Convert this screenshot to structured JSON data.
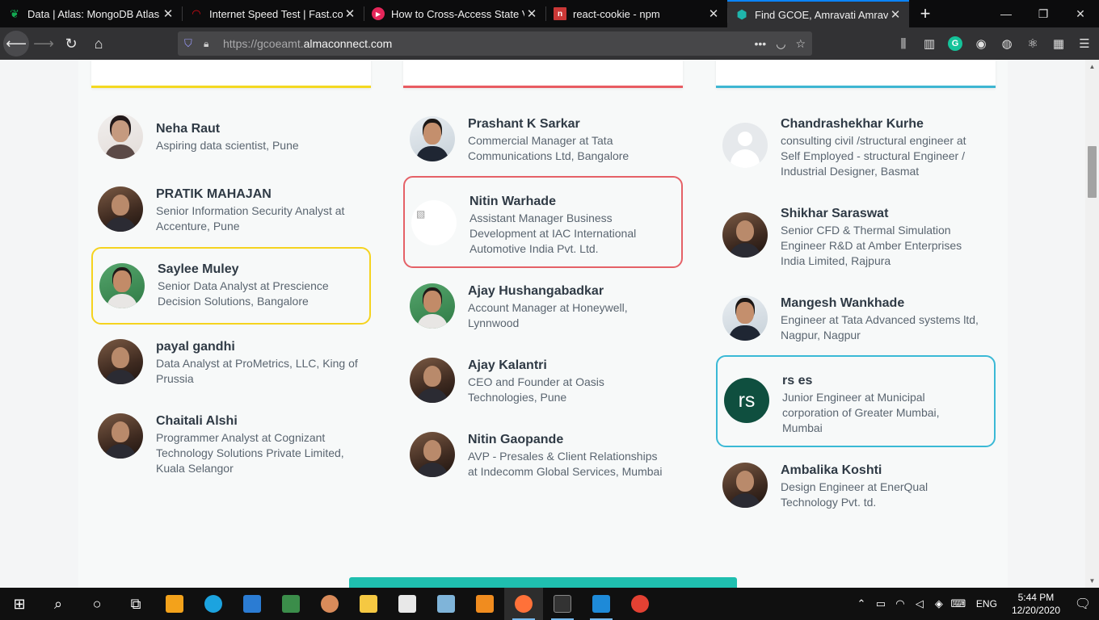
{
  "browser": {
    "tabs": [
      {
        "title": "Data | Atlas: MongoDB Atlas",
        "icon": "leaf-icon",
        "color": "#13aa52"
      },
      {
        "title": "Internet Speed Test | Fast.com",
        "icon": "speedometer-icon",
        "color": "#e50914"
      },
      {
        "title": "How to Cross-Access State Valu",
        "icon": "play-icon",
        "color": "#e5265a"
      },
      {
        "title": "react-cookie - npm",
        "icon": "npm-icon",
        "color": "#cb3837"
      },
      {
        "title": "Find GCOE, Amravati Amravati",
        "icon": "hexagon-icon",
        "color": "#1fb5ac"
      }
    ],
    "new_tab_symbol": "+",
    "url_prefix": "https://gcoeamt.",
    "url_domain": "almaconnect.com"
  },
  "columns": [
    {
      "accent": "#f4d821",
      "people": [
        {
          "name": "Neha Raut",
          "desc": "Aspiring data scientist, Pune",
          "avatar": "av-light"
        },
        {
          "name": "PRATIK MAHAJAN",
          "desc": "Senior Information Security Analyst at Accenture, Pune",
          "avatar": "av-photo"
        },
        {
          "name": "Saylee Muley",
          "desc": "Senior Data Analyst at Prescience Decision Solutions, Bangalore",
          "avatar": "av-green",
          "highlight": true
        },
        {
          "name": "payal gandhi",
          "desc": "Data Analyst at ProMetrics, LLC, King of Prussia",
          "avatar": "av-photo"
        },
        {
          "name": "Chaitali Alshi",
          "desc": "Programmer Analyst at Cognizant Technology Solutions Private Limited, Kuala Selangor",
          "avatar": "av-photo"
        }
      ]
    },
    {
      "accent": "#e85b62",
      "people": [
        {
          "name": "Prashant K Sarkar",
          "desc": "Commercial Manager at Tata Communications Ltd, Bangalore",
          "avatar": "av-suit"
        },
        {
          "name": "Nitin Warhade",
          "desc": "Assistant Manager Business Development at IAC International Automotive India Pvt. Ltd.",
          "avatar": "av-broken",
          "highlight": true
        },
        {
          "name": "Ajay Hushangabadkar",
          "desc": "Account Manager at Honeywell, Lynnwood",
          "avatar": "av-green"
        },
        {
          "name": "Ajay Kalantri",
          "desc": "CEO and Founder at Oasis Technologies, Pune",
          "avatar": "av-photo"
        },
        {
          "name": "Nitin Gaopande",
          "desc": "AVP - Presales & Client Relationships at Indecomm Global Services, Mumbai",
          "avatar": "av-photo"
        }
      ]
    },
    {
      "accent": "#3eb6d2",
      "people": [
        {
          "name": "Chandrashekhar Kurhe",
          "desc": "consulting civil /structural engineer at Self Employed - structural Engineer / Industrial Designer, Basmat",
          "avatar": "av-blank"
        },
        {
          "name": "Shikhar Saraswat",
          "desc": "Senior CFD & Thermal Simulation Engineer R&D at Amber Enterprises India Limited, Rajpura",
          "avatar": "av-photo"
        },
        {
          "name": "Mangesh Wankhade",
          "desc": "Engineer at Tata Advanced systems ltd, Nagpur, Nagpur",
          "avatar": "av-suit"
        },
        {
          "name": "rs es",
          "desc": "Junior Engineer at Municipal corporation of Greater Mumbai, Mumbai",
          "avatar": "av-initials",
          "initials": "rs",
          "highlight": true
        },
        {
          "name": "Ambalika Koshti",
          "desc": "Design Engineer at EnerQual Technology Pvt. td.",
          "avatar": "av-photo"
        }
      ]
    }
  ],
  "taskbar": {
    "language": "ENG",
    "time": "5:44 PM",
    "date": "12/20/2020"
  }
}
